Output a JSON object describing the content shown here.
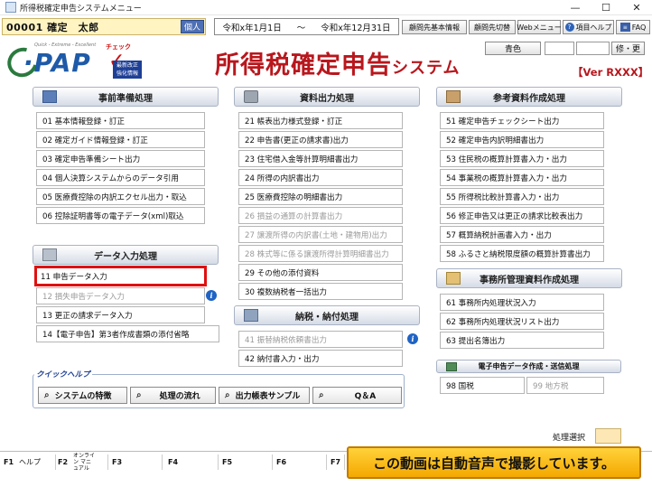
{
  "window": {
    "title": "所得税確定申告システムメニュー",
    "controls": {
      "minimize": "—",
      "maximize": "☐",
      "close": "✕"
    }
  },
  "topbar": {
    "user": "00001 確定　太郎",
    "individual": "個人",
    "period_start": "令和x年1月1日",
    "period_sep": "～",
    "period_end": "令和x年12月31日",
    "buttons": [
      {
        "label": "顧問先基本情報"
      },
      {
        "label": "顧問先切替"
      },
      {
        "label": "Webメニュー"
      },
      {
        "label": "項目ヘルプ"
      },
      {
        "label": "FAQ"
      }
    ]
  },
  "logo": {
    "tagline": "Quick - Extreme - Excellent",
    "name": "PAP",
    "check": "チェック",
    "badge_line1": "最新改正",
    "badge_line2": "強化情報"
  },
  "app_title": {
    "main": "所得税確定申告",
    "suffix": "システム"
  },
  "version": "【Ver RXXX】",
  "color_button": "青色",
  "fix_button": "修・更",
  "sections": {
    "preparation": {
      "title": "事前準備処理",
      "items": [
        {
          "label": "01 基本情報登録・訂正",
          "disabled": false
        },
        {
          "label": "02 確定ガイド情報登録・訂正",
          "disabled": false
        },
        {
          "label": "03 確定申告準備シート出力",
          "disabled": false
        },
        {
          "label": "04 個人決算システムからのデータ引用",
          "disabled": false
        },
        {
          "label": "05 医療費控除の内訳エクセル出力・取込",
          "disabled": false
        },
        {
          "label": "06 控除証明書等の電子データ(xml)取込",
          "disabled": false
        }
      ]
    },
    "data_input": {
      "title": "データ入力処理",
      "items": [
        {
          "label": "11 申告データ入力",
          "disabled": false
        },
        {
          "label": "12 損失申告データ入力",
          "disabled": true
        },
        {
          "label": "13 更正の請求データ入力",
          "disabled": false
        },
        {
          "label": "14【電子申告】第3者作成書類の添付省略",
          "disabled": false
        }
      ]
    },
    "output": {
      "title": "資料出力処理",
      "items": [
        {
          "label": "21 帳表出力様式登録・訂正",
          "disabled": false
        },
        {
          "label": "22 申告書(更正の請求書)出力",
          "disabled": false
        },
        {
          "label": "23 住宅借入金等計算明細書出力",
          "disabled": false
        },
        {
          "label": "24 所得の内訳書出力",
          "disabled": false
        },
        {
          "label": "25 医療費控除の明細書出力",
          "disabled": false
        },
        {
          "label": "26 損益の通算の計算書出力",
          "disabled": true
        },
        {
          "label": "27 譲渡所得の内訳書(土地・建物用)出力",
          "disabled": true
        },
        {
          "label": "28 株式等に係る譲渡所得計算明細書出力",
          "disabled": true
        },
        {
          "label": "29 その他の添付資料",
          "disabled": false
        },
        {
          "label": "30 複数納税者一括出力",
          "disabled": false
        }
      ]
    },
    "payment": {
      "title": "納税・納付処理",
      "items": [
        {
          "label": "41 振替納税依頼書出力",
          "disabled": true
        },
        {
          "label": "42 納付書入力・出力",
          "disabled": false
        }
      ]
    },
    "reference": {
      "title": "参考資料作成処理",
      "items": [
        {
          "label": "51 確定申告チェックシート出力",
          "disabled": false
        },
        {
          "label": "52 確定申告内訳明細書出力",
          "disabled": false
        },
        {
          "label": "53 住民税の概算計算書入力・出力",
          "disabled": false
        },
        {
          "label": "54 事業税の概算計算書入力・出力",
          "disabled": false
        },
        {
          "label": "55 所得税比較計算書入力・出力",
          "disabled": false
        },
        {
          "label": "56 修正申告又は更正の請求比較表出力",
          "disabled": false
        },
        {
          "label": "57 概算納税計画書入力・出力",
          "disabled": false
        },
        {
          "label": "58 ふるさと納税限度額の概算計算書出力",
          "disabled": false
        }
      ]
    },
    "office": {
      "title": "事務所管理資料作成処理",
      "items": [
        {
          "label": "61 事務所内処理状況入力",
          "disabled": false
        },
        {
          "label": "62 事務所内処理状況リスト出力",
          "disabled": false
        },
        {
          "label": "63 提出名簿出力",
          "disabled": false
        }
      ]
    },
    "efile": {
      "title": "電子申告データ作成・送信処理",
      "items": [
        {
          "label": "98 国税",
          "disabled": false
        },
        {
          "label": "99 地方税",
          "disabled": true
        }
      ]
    }
  },
  "quick_help": {
    "title": "クイックヘルプ",
    "buttons": [
      {
        "label": "システムの特徴"
      },
      {
        "label": "処理の流れ"
      },
      {
        "label": "出力帳表サンプル"
      },
      {
        "label": "Q＆A"
      }
    ]
  },
  "process_select_label": "処理選択",
  "fkeys": [
    {
      "key": "F1",
      "label": "ヘルプ"
    },
    {
      "key": "F2",
      "label": "オンライン マニュアル"
    },
    {
      "key": "F3",
      "label": ""
    },
    {
      "key": "F4",
      "label": ""
    },
    {
      "key": "F5",
      "label": ""
    },
    {
      "key": "F6",
      "label": ""
    },
    {
      "key": "F7",
      "label": ""
    }
  ],
  "banner": "この動画は自動音声で撮影しています。"
}
